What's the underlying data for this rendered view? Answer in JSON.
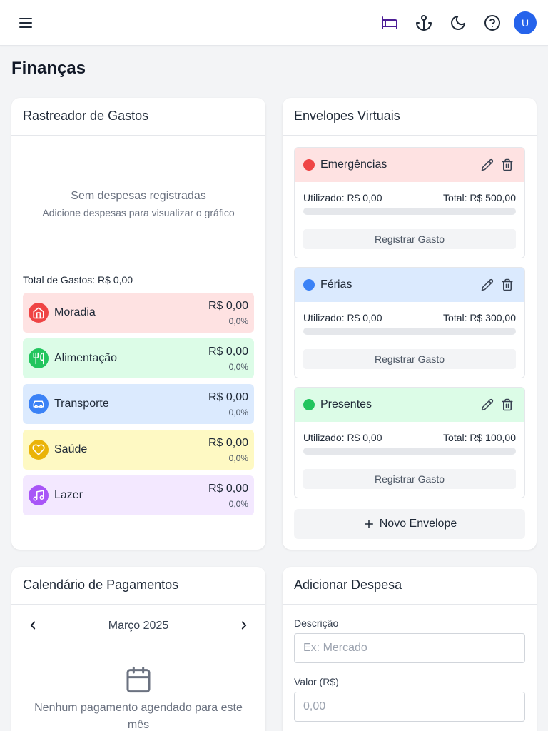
{
  "header": {
    "icons": [
      "menu-icon",
      "bed-icon",
      "anchor-icon",
      "moon-icon",
      "help-icon"
    ],
    "avatar_initial": "U",
    "accent_color": "#4c1d95"
  },
  "page": {
    "title": "Finanças"
  },
  "expense_tracker": {
    "title": "Rastreador de Gastos",
    "empty_title": "Sem despesas registradas",
    "empty_subtitle": "Adicione despesas para visualizar o gráfico",
    "total_label": "Total de Gastos: R$ 0,00",
    "categories": [
      {
        "name": "Moradia",
        "value": "R$ 0,00",
        "percent": "0,0%",
        "icon": "home-icon",
        "bg": "#fee2e2",
        "icon_bg": "#ef4444"
      },
      {
        "name": "Alimentação",
        "value": "R$ 0,00",
        "percent": "0,0%",
        "icon": "utensils-icon",
        "bg": "#dcfce7",
        "icon_bg": "#22c55e"
      },
      {
        "name": "Transporte",
        "value": "R$ 0,00",
        "percent": "0,0%",
        "icon": "car-icon",
        "bg": "#dbeafe",
        "icon_bg": "#3b82f6"
      },
      {
        "name": "Saúde",
        "value": "R$ 0,00",
        "percent": "0,0%",
        "icon": "heart-icon",
        "bg": "#fef9c3",
        "icon_bg": "#eab308"
      },
      {
        "name": "Lazer",
        "value": "R$ 0,00",
        "percent": "0,0%",
        "icon": "music-icon",
        "bg": "#f3e8ff",
        "icon_bg": "#a855f7"
      }
    ]
  },
  "envelopes": {
    "title": "Envelopes Virtuais",
    "items": [
      {
        "name": "Emergências",
        "used": "Utilizado: R$ 0,00",
        "total": "Total: R$ 500,00",
        "progress": 0,
        "button": "Registrar Gasto",
        "color": "#ef4444",
        "bg": "#fee2e2"
      },
      {
        "name": "Férias",
        "used": "Utilizado: R$ 0,00",
        "total": "Total: R$ 300,00",
        "progress": 0,
        "button": "Registrar Gasto",
        "color": "#3b82f6",
        "bg": "#dbeafe"
      },
      {
        "name": "Presentes",
        "used": "Utilizado: R$ 0,00",
        "total": "Total: R$ 100,00",
        "progress": 0,
        "button": "Registrar Gasto",
        "color": "#22c55e",
        "bg": "#dcfce7"
      }
    ],
    "new_button": "Novo Envelope"
  },
  "calendar": {
    "title": "Calendário de Pagamentos",
    "month": "Março 2025",
    "empty_text": "Nenhum pagamento agendado para este mês"
  },
  "add_expense": {
    "title": "Adicionar Despesa",
    "description_label": "Descrição",
    "description_placeholder": "Ex: Mercado",
    "value_label": "Valor (R$)",
    "value_placeholder": "0,00"
  }
}
